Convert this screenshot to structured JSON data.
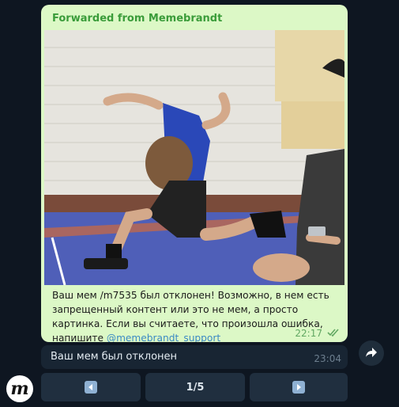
{
  "forwarded_message": {
    "header": "Forwarded from Memebrandt",
    "text": "Ваш мем /m7535 был отклонен! Возможно, в нем есть запрещенный контент или это не мем, а просто картинка. Если вы считаете, что произошла ошибка, напишите",
    "link": "@memebrandt_support",
    "time": "22:17"
  },
  "bot_message": {
    "text": "Ваш мем был отклонен",
    "time": "23:04"
  },
  "keyboard": {
    "page_indicator": "1/5"
  },
  "icons": {
    "share": "share-arrow-icon",
    "read_status": "double-check-icon",
    "prev": "prev-arrow-icon",
    "next": "next-arrow-icon",
    "avatar": "memebrandt-logo-avatar"
  },
  "colors": {
    "background": "#0e1621",
    "forwarded_bubble": "#dcf8c6",
    "forwarded_header": "#3a9c3a",
    "link": "#3b8ac4",
    "bot_bubble": "#182533",
    "keyboard_button": "#202f3f"
  }
}
